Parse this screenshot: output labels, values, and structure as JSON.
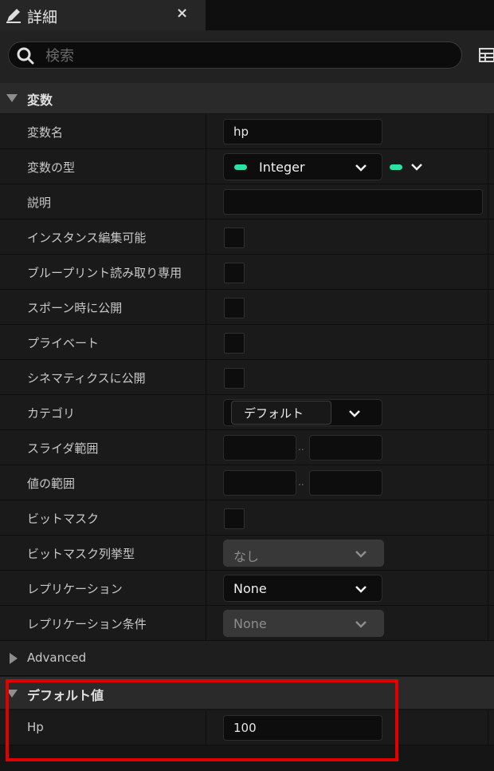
{
  "tab": {
    "title": "詳細",
    "close": "×"
  },
  "search": {
    "placeholder": "検索",
    "value": ""
  },
  "sections": {
    "variables": "変数",
    "advanced": "Advanced",
    "default_value": "デフォルト値"
  },
  "rows": {
    "var_name": {
      "label": "変数名",
      "value": "hp"
    },
    "var_type": {
      "label": "変数の型",
      "value": "Integer",
      "pin_color": "#2de0a7"
    },
    "description": {
      "label": "説明",
      "value": ""
    },
    "instance_editable": {
      "label": "インスタンス編集可能"
    },
    "blueprint_readonly": {
      "label": "ブループリント読み取り専用"
    },
    "expose_on_spawn": {
      "label": "スポーン時に公開"
    },
    "private": {
      "label": "プライベート"
    },
    "expose_cinematics": {
      "label": "シネマティクスに公開"
    },
    "category": {
      "label": "カテゴリ",
      "value": "デフォルト"
    },
    "slider_range": {
      "label": "スライダ範囲",
      "separator": ".."
    },
    "value_range": {
      "label": "値の範囲",
      "separator": ".."
    },
    "bitmask": {
      "label": "ビットマスク"
    },
    "bitmask_enum": {
      "label": "ビットマスク列挙型",
      "value": "なし"
    },
    "replication": {
      "label": "レプリケーション",
      "value": "None"
    },
    "replication_condition": {
      "label": "レプリケーション条件",
      "value": "None"
    },
    "hp": {
      "label": "Hp",
      "value": "100"
    }
  },
  "colors": {
    "highlight": "#e00000",
    "accent": "#2de0a7"
  }
}
